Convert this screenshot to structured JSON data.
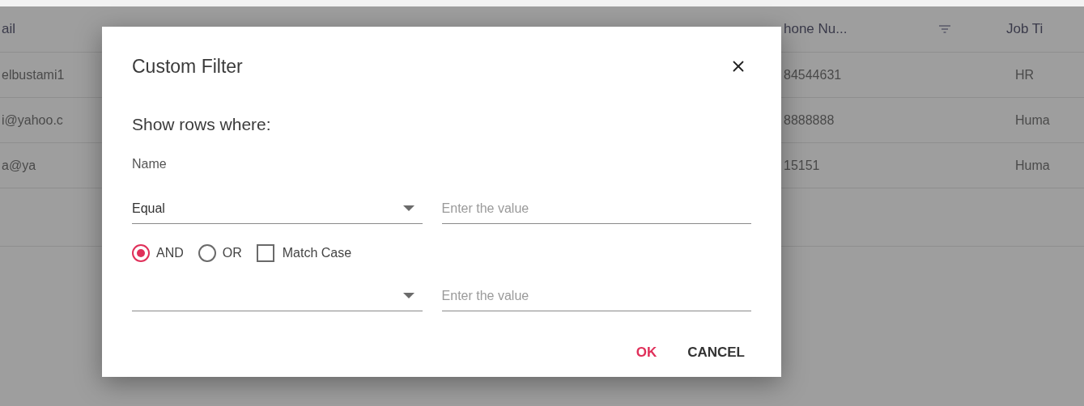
{
  "table": {
    "columns": [
      "ail",
      "hone Nu...",
      "Job Ti"
    ],
    "rows": [
      [
        "elbustami1",
        "84544631",
        "HR"
      ],
      [
        "i@yahoo.c",
        "8888888",
        "Huma"
      ],
      [
        "a@ya",
        "15151",
        "Huma"
      ]
    ]
  },
  "dialog": {
    "title": "Custom Filter",
    "subtitle": "Show rows where:",
    "field_label": "Name",
    "conditions": [
      {
        "operator": "Equal",
        "placeholder": "Enter the value"
      },
      {
        "placeholder": "Enter the value"
      }
    ],
    "logic": [
      {
        "label": "AND",
        "selected": true
      },
      {
        "label": "OR",
        "selected": false
      }
    ],
    "match_case": {
      "label": "Match Case",
      "checked": false
    },
    "buttons": [
      {
        "label": "OK",
        "kind": "primary"
      },
      {
        "label": "CANCEL",
        "kind": "secondary"
      }
    ]
  }
}
